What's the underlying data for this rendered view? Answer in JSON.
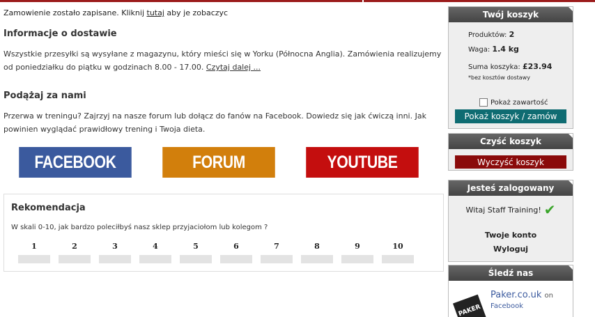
{
  "notice": {
    "before": "Zamowienie zostało zapisane. Kliknij ",
    "link": "tutaj",
    "after": " aby je zobaczyc"
  },
  "delivery": {
    "title": "Informacje o dostawie",
    "text": "Wszystkie przesyłki są wysyłane z magazynu, który mieści się w Yorku (Północna Anglia). Zamówienia realizujemy od poniedziałku do piątku w godzinach 8.00 - 17.00. ",
    "more": "Czytaj dalej ..."
  },
  "follow_section": {
    "title": "Podążaj za nami",
    "text": "Przerwa w treningu? Zajrzyj na nasze forum lub dołącz do fanów na Facebook. Dowiedz się jak ćwiczą inni. Jak powinien wyglądać prawidłowy trening i Twoja dieta."
  },
  "social": {
    "facebook": "FACEBOOK",
    "forum": "FORUM",
    "youtube": "YOUTUBE",
    "colors": {
      "facebook": "#3b5a9e",
      "forum": "#d27f0c",
      "youtube": "#c40e0e"
    }
  },
  "recommend": {
    "title": "Rekomendacja",
    "question": "W skali 0-10, jak bardzo poleciłbyś nasz sklep przyjaciołom lub kolegom ?",
    "options": [
      "1",
      "2",
      "3",
      "4",
      "5",
      "6",
      "7",
      "8",
      "9",
      "10"
    ]
  },
  "cart": {
    "title": "Twój koszyk",
    "products_label": "Produktów:",
    "products_value": "2",
    "weight_label": "Waga:",
    "weight_value": "1.4 kg",
    "sum_label": "Suma koszyka:",
    "sum_value": "£23.94",
    "shipping_note": "*bez kosztów dostawy",
    "show_contents": "Pokaż zawartość",
    "checkout_button": "Pokaż koszyk / zamów"
  },
  "clear_cart": {
    "title": "Czyść koszyk",
    "button": "Wyczyść koszyk"
  },
  "logged": {
    "title": "Jesteś zalogowany",
    "welcome": "Witaj Staff Training!",
    "account": "Twoje konto",
    "logout": "Wyloguj"
  },
  "follow_box": {
    "title": "Śledź nas",
    "site": "Paker.co.uk",
    "on": "on",
    "network": "Facebook",
    "logo_text": "PAKER"
  },
  "colors": {
    "accent": "#9b1b1b",
    "teal_button": "#0f6c72",
    "red_button": "#8a0a0a"
  }
}
